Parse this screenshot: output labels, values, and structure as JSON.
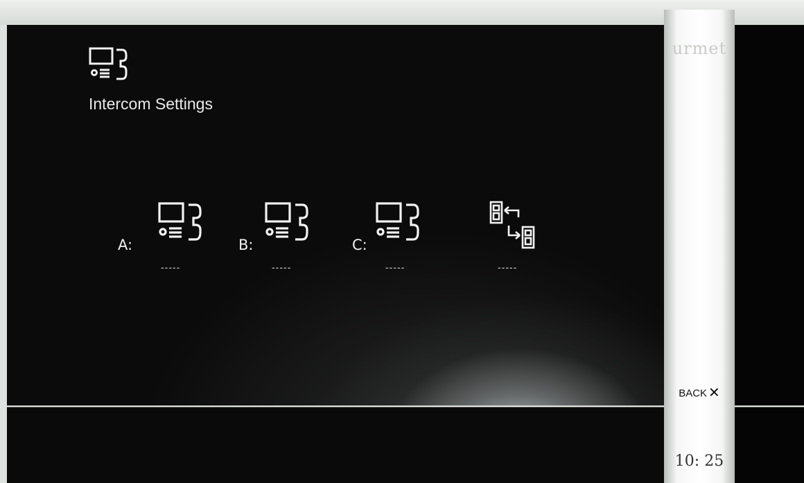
{
  "header": {
    "icon": "intercom-icon",
    "title": "Intercom Settings"
  },
  "items": [
    {
      "label": "A:",
      "value": "-----",
      "icon": "intercom-icon"
    },
    {
      "label": "B:",
      "value": "-----",
      "icon": "intercom-icon"
    },
    {
      "label": "C:",
      "value": "-----",
      "icon": "intercom-icon"
    },
    {
      "label": "",
      "value": "-----",
      "icon": "call-transfer-icon"
    }
  ],
  "sidebar": {
    "brand": "urmet",
    "back_label": "BACK",
    "back_icon": "close-icon",
    "clock": "10: 25"
  },
  "colors": {
    "screen_bg": "#0b0b0b",
    "text": "#e9e9e9",
    "side_strip": "#ffffff"
  }
}
